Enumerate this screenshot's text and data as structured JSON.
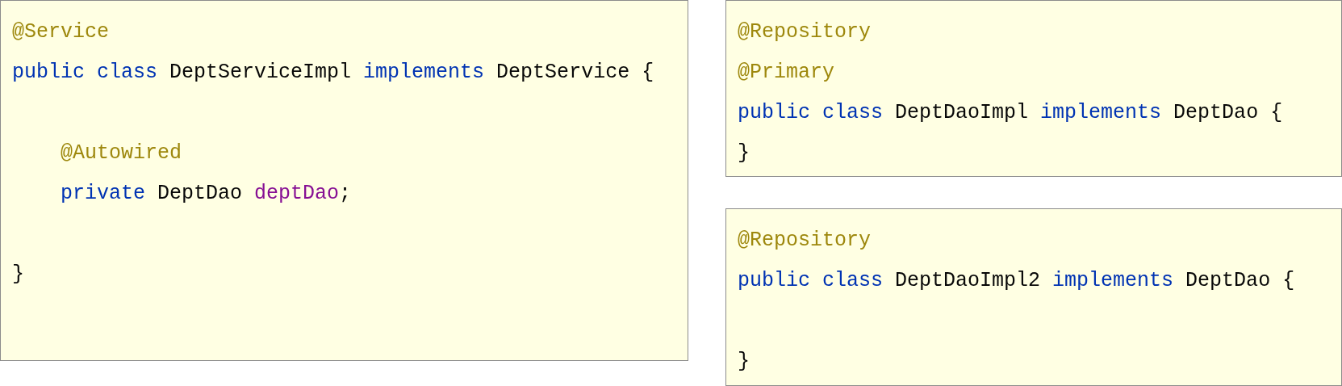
{
  "panels": [
    {
      "lines": [
        {
          "kind": "code",
          "indented": false,
          "tokens": [
            {
              "text": "@Service",
              "kind": "annotation"
            }
          ]
        },
        {
          "kind": "code",
          "indented": false,
          "tokens": [
            {
              "text": "public",
              "kind": "keyword"
            },
            {
              "text": " class",
              "kind": "keyword"
            },
            {
              "text": " DeptServiceImpl ",
              "kind": "plain"
            },
            {
              "text": "implements",
              "kind": "keyword"
            },
            {
              "text": " DeptService {",
              "kind": "plain"
            }
          ]
        },
        {
          "kind": "blank"
        },
        {
          "kind": "code",
          "indented": true,
          "tokens": [
            {
              "text": "@Autowired",
              "kind": "annotation"
            }
          ]
        },
        {
          "kind": "code",
          "indented": true,
          "tokens": [
            {
              "text": "private",
              "kind": "keyword"
            },
            {
              "text": " DeptDao ",
              "kind": "plain"
            },
            {
              "text": "deptDao",
              "kind": "field"
            },
            {
              "text": ";",
              "kind": "plain"
            }
          ]
        },
        {
          "kind": "blank"
        },
        {
          "kind": "code",
          "indented": false,
          "tokens": [
            {
              "text": "}",
              "kind": "plain"
            }
          ]
        }
      ]
    },
    {
      "lines": [
        {
          "kind": "code",
          "indented": false,
          "tokens": [
            {
              "text": "@Repository",
              "kind": "annotation"
            }
          ]
        },
        {
          "kind": "code",
          "indented": false,
          "tokens": [
            {
              "text": "@Primary",
              "kind": "annotation"
            }
          ]
        },
        {
          "kind": "code",
          "indented": false,
          "tokens": [
            {
              "text": "public",
              "kind": "keyword"
            },
            {
              "text": " class",
              "kind": "keyword"
            },
            {
              "text": " DeptDaoImpl ",
              "kind": "plain"
            },
            {
              "text": "implements",
              "kind": "keyword"
            },
            {
              "text": " DeptDao {",
              "kind": "plain"
            }
          ]
        },
        {
          "kind": "code",
          "indented": false,
          "tokens": [
            {
              "text": "}",
              "kind": "plain"
            }
          ]
        }
      ]
    },
    {
      "lines": [
        {
          "kind": "code",
          "indented": false,
          "tokens": [
            {
              "text": "@Repository",
              "kind": "annotation"
            }
          ]
        },
        {
          "kind": "code",
          "indented": false,
          "tokens": [
            {
              "text": "public",
              "kind": "keyword"
            },
            {
              "text": " class",
              "kind": "keyword"
            },
            {
              "text": " DeptDaoImpl2 ",
              "kind": "plain"
            },
            {
              "text": "implements",
              "kind": "keyword"
            },
            {
              "text": " DeptDao {",
              "kind": "plain"
            }
          ]
        },
        {
          "kind": "blank"
        },
        {
          "kind": "code",
          "indented": false,
          "tokens": [
            {
              "text": "}",
              "kind": "plain"
            }
          ]
        }
      ]
    }
  ]
}
